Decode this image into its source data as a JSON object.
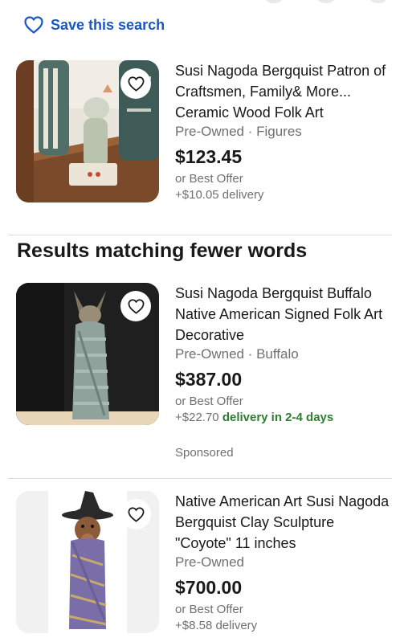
{
  "save_search": {
    "label": "Save this search",
    "icon": "heart-outline-icon",
    "color": "#1a57c6"
  },
  "section_heading": "Results matching fewer words",
  "sponsored_label": "Sponsored",
  "listings": [
    {
      "title": "Susi Nagoda Bergquist Patron of Craftsmen, Family& More... Ceramic Wood Folk Art",
      "condition": "Pre-Owned · Figures",
      "price": "$123.45",
      "offer": "or Best Offer",
      "delivery": "+$10.05 delivery",
      "watch_icon": "heart-outline-icon"
    },
    {
      "title": "Susi Nagoda Bergquist Buffalo Native American Signed Folk Art Decorative",
      "condition": "Pre-Owned · Buffalo",
      "price": "$387.00",
      "offer": "or Best Offer",
      "delivery": "+$22.70",
      "delivery_speed": "delivery in 2-4 days",
      "watch_icon": "heart-outline-icon"
    },
    {
      "title": "Native American Art Susi Nagoda Bergquist Clay Sculpture \"Coyote\" 11 inches",
      "condition": "Pre-Owned",
      "price": "$700.00",
      "offer": "or Best Offer",
      "delivery": "+$8.58 delivery",
      "watch_icon": "heart-outline-icon"
    }
  ],
  "colors": {
    "link_blue": "#1a57c6",
    "fast_delivery_green": "#2e7d32",
    "secondary_text": "#707070"
  }
}
